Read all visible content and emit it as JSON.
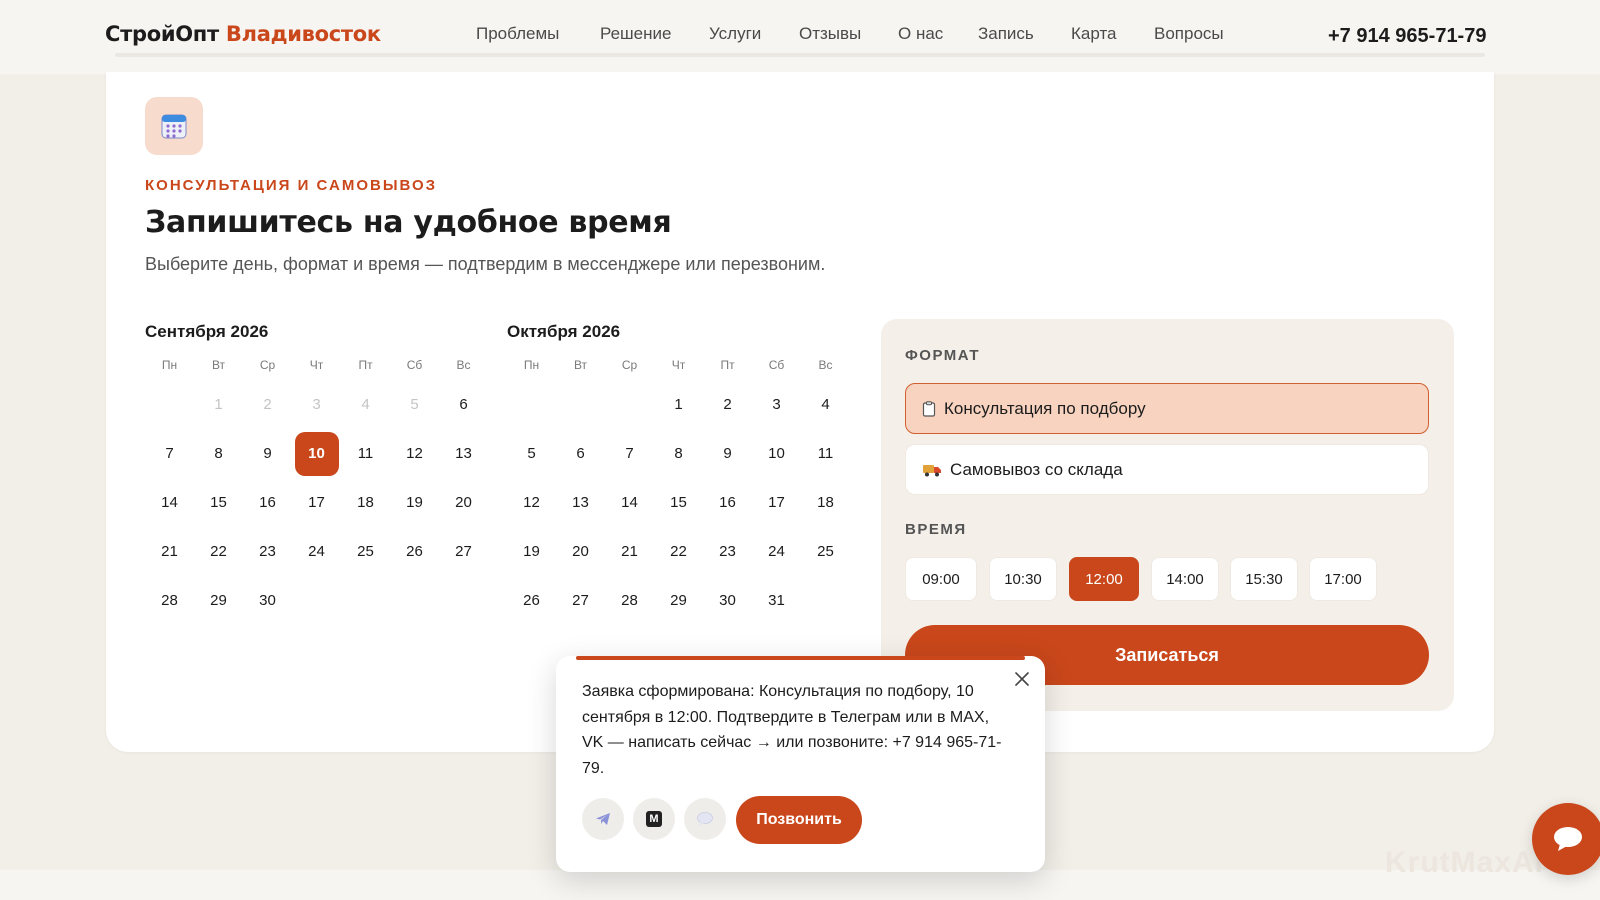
{
  "header": {
    "logo_main": "СтройОпт",
    "logo_accent": "Владивосток",
    "nav": [
      "Проблемы",
      "Решение",
      "Услуги",
      "Отзывы",
      "О нас",
      "Запись",
      "Карта",
      "Вопросы"
    ],
    "phone": "+7 914 965-71-79"
  },
  "booking": {
    "eyebrow": "КОНСУЛЬТАЦИЯ И САМОВЫВОЗ",
    "title": "Запишитесь на удобное время",
    "subtitle": "Выберите день, формат и время — подтвердим в мессенджере или перезвоним."
  },
  "calendar": {
    "weekdays": [
      "Пн",
      "Вт",
      "Ср",
      "Чт",
      "Пт",
      "Сб",
      "Вс"
    ],
    "months": [
      {
        "title": "Сентября 2026",
        "leading_blanks": 1,
        "days": [
          "1",
          "2",
          "3",
          "4",
          "5",
          "6",
          "7",
          "8",
          "9",
          "10",
          "11",
          "12",
          "13",
          "14",
          "15",
          "16",
          "17",
          "18",
          "19",
          "20",
          "21",
          "22",
          "23",
          "24",
          "25",
          "26",
          "27",
          "28",
          "29",
          "30"
        ],
        "disabled_days": [
          "1",
          "2",
          "3",
          "4",
          "5"
        ],
        "selected_day": "10"
      },
      {
        "title": "Октября 2026",
        "leading_blanks": 3,
        "days": [
          "1",
          "2",
          "3",
          "4",
          "5",
          "6",
          "7",
          "8",
          "9",
          "10",
          "11",
          "12",
          "13",
          "14",
          "15",
          "16",
          "17",
          "18",
          "19",
          "20",
          "21",
          "22",
          "23",
          "24",
          "25",
          "26",
          "27",
          "28",
          "29",
          "30",
          "31"
        ],
        "disabled_days": [],
        "selected_day": ""
      }
    ]
  },
  "panel": {
    "format_label": "ФОРМАТ",
    "formats": [
      {
        "label": "Консультация по подбору",
        "icon": "clipboard-icon",
        "active": true
      },
      {
        "label": "Самовывоз со склада",
        "icon": "truck-icon",
        "active": false
      }
    ],
    "time_label": "ВРЕМЯ",
    "times": [
      "09:00",
      "10:30",
      "12:00",
      "14:00",
      "15:30",
      "17:00"
    ],
    "selected_time": "12:00",
    "submit_label": "Записаться"
  },
  "toast": {
    "message": "Заявка сформирована: Консультация по подбору, 10 сентября в 12:00. Подтвердите в Телеграм или в MAX, VK — написать сейчас → или позвоните: +7 914 965-71-79.",
    "call_label": "Позвонить",
    "max_letter": "M"
  },
  "watermark": "KrutMaxAI",
  "colors": {
    "accent": "#c9471b",
    "accent_soft": "#f7d3c0",
    "page_bg": "#f2eee8",
    "panel_bg": "#f4efe9"
  }
}
